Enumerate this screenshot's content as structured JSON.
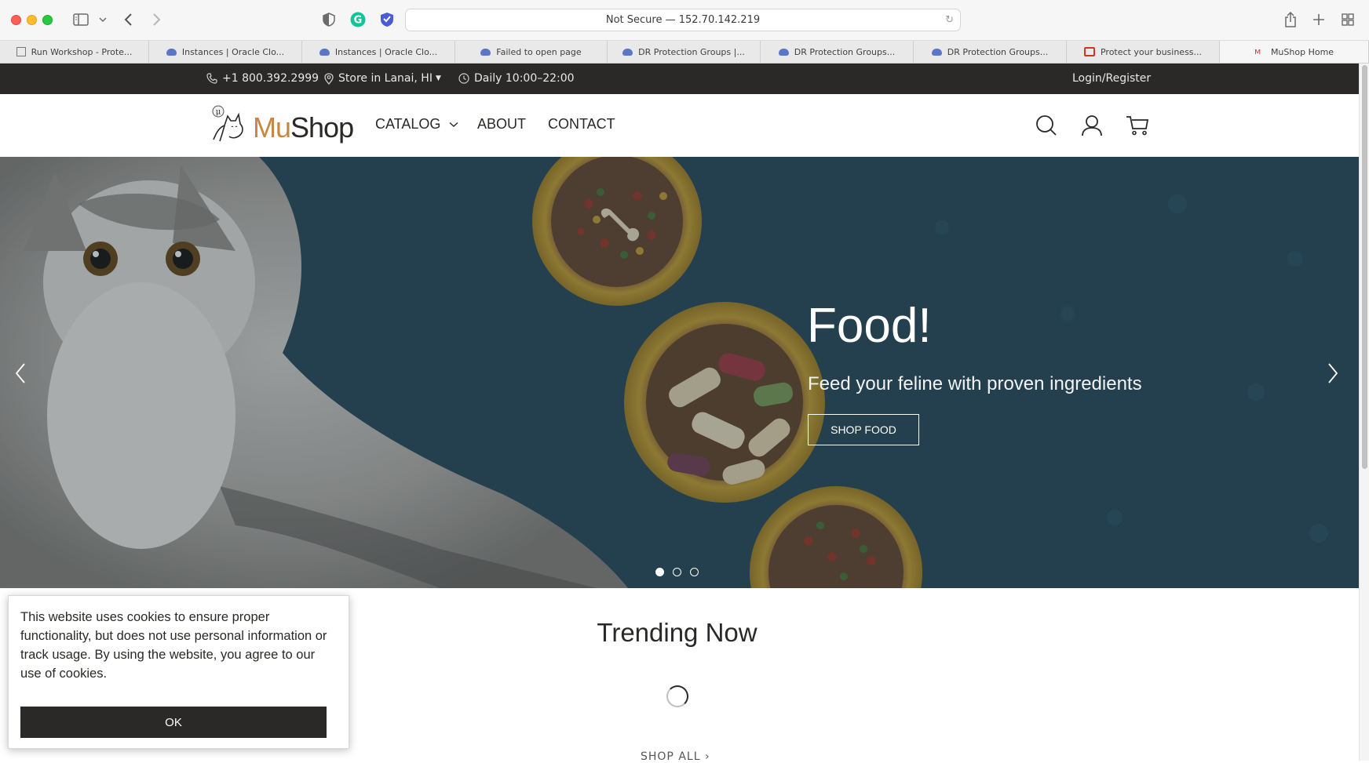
{
  "browser": {
    "url": "Not Secure — 152.70.142.219",
    "tabs": [
      {
        "label": "Run Workshop - Prote...",
        "icon": "image-icon",
        "active": false
      },
      {
        "label": "Instances | Oracle Clo...",
        "icon": "cloud-icon",
        "active": false
      },
      {
        "label": "Instances | Oracle Clo...",
        "icon": "cloud-icon",
        "active": false
      },
      {
        "label": "Failed to open page",
        "icon": "cloud-icon",
        "active": false
      },
      {
        "label": "DR Protection Groups |...",
        "icon": "cloud-icon",
        "active": false
      },
      {
        "label": "DR Protection Groups...",
        "icon": "cloud-icon",
        "active": false
      },
      {
        "label": "DR Protection Groups...",
        "icon": "cloud-icon",
        "active": false
      },
      {
        "label": "Protect your business...",
        "icon": "oracle-icon",
        "active": false
      },
      {
        "label": "MuShop Home",
        "icon": "mushop-icon",
        "active": true
      }
    ]
  },
  "topbar": {
    "phone": "+1 800.392.2999",
    "store": "Store in Lanai, HI",
    "hours": "Daily 10:00–22:00",
    "login": "Login/Register"
  },
  "header": {
    "logo_mu": "Mu",
    "logo_shop": "Shop",
    "logo_badge": "μ",
    "nav": {
      "catalog": "CATALOG",
      "about": "ABOUT",
      "contact": "CONTACT"
    }
  },
  "hero": {
    "title": "Food!",
    "subtitle": "Feed your feline with proven ingredients",
    "button": "SHOP FOOD",
    "slide_count": 3,
    "active_slide": 1
  },
  "trending": {
    "title": "Trending Now",
    "shop_all": "SHOP ALL"
  },
  "cookie": {
    "text": "This website uses cookies to ensure proper functionality, but does not use personal information or track usage. By using the website, you agree to our use of cookies.",
    "button": "OK"
  }
}
